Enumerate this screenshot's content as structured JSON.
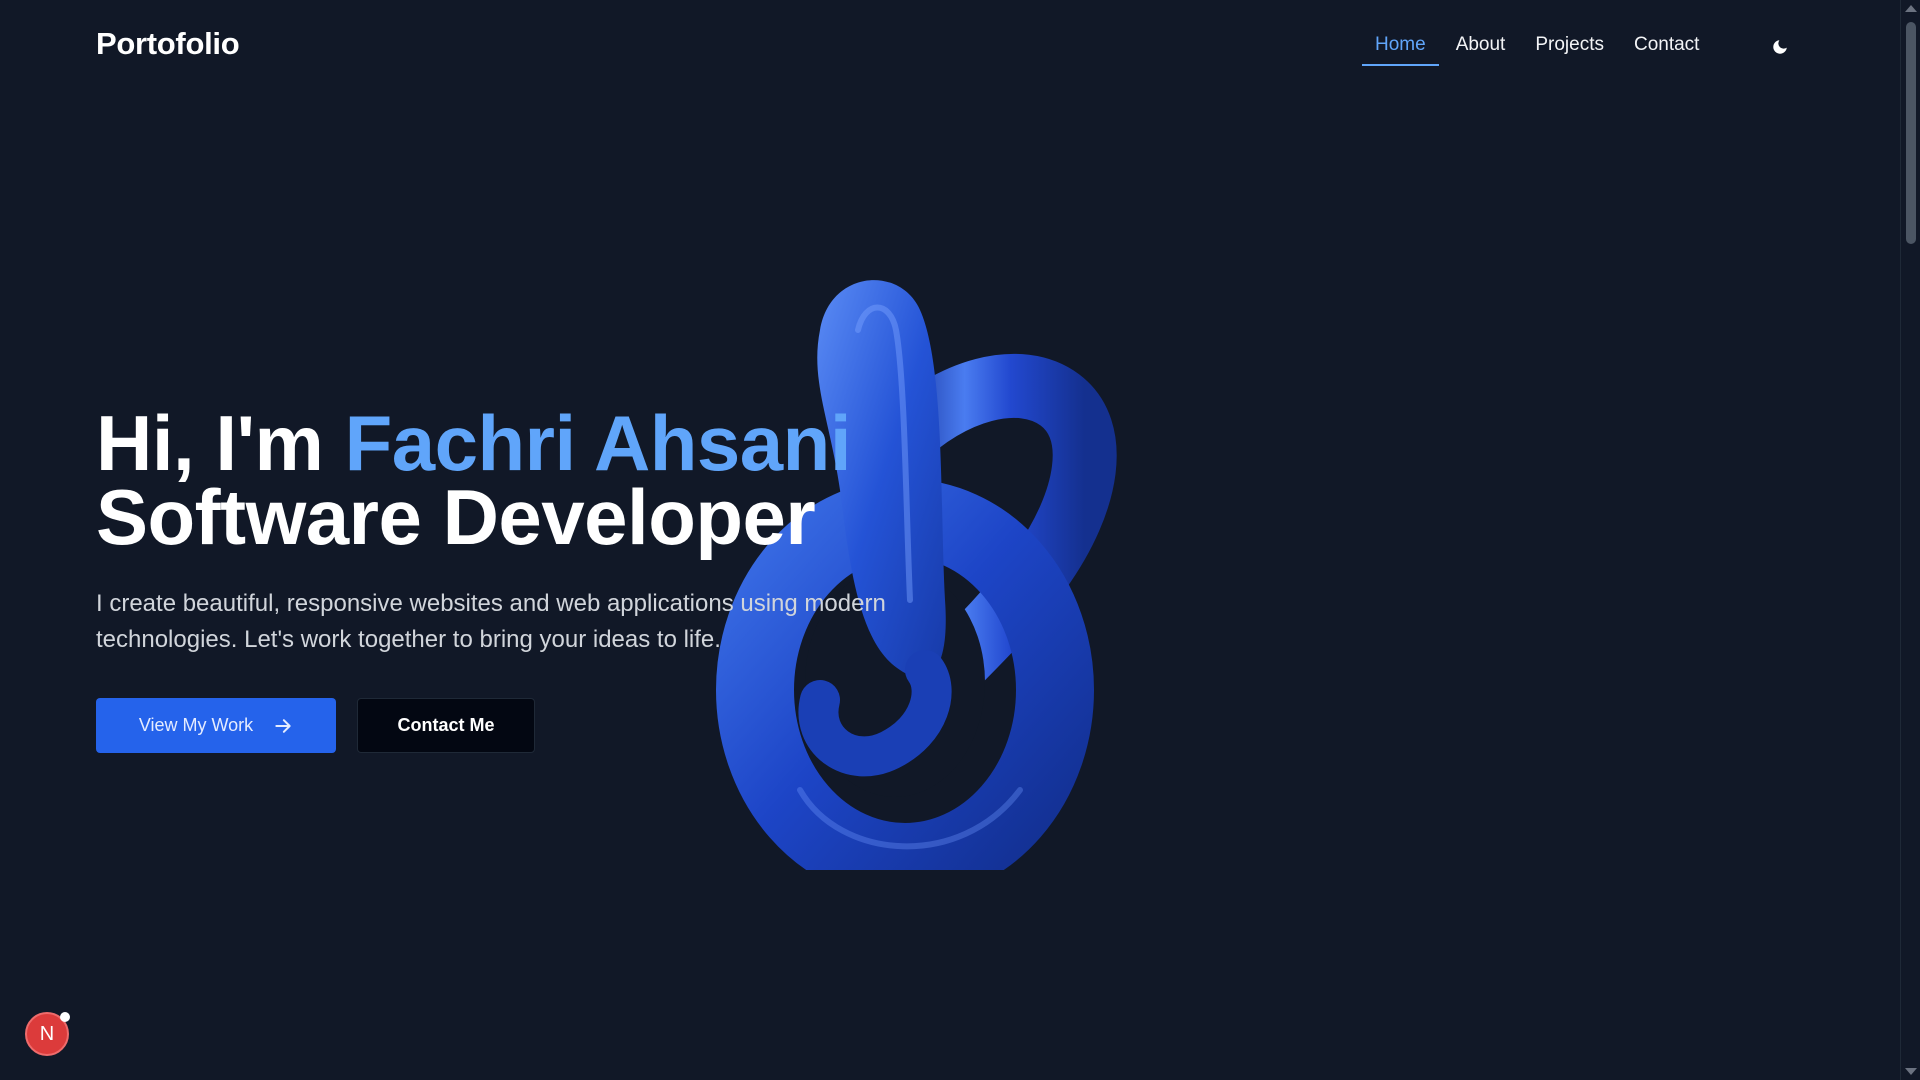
{
  "header": {
    "brand": "Portofolio",
    "nav": [
      {
        "label": "Home",
        "active": true
      },
      {
        "label": "About",
        "active": false
      },
      {
        "label": "Projects",
        "active": false
      },
      {
        "label": "Contact",
        "active": false
      }
    ],
    "theme_icon": "moon-icon"
  },
  "hero": {
    "greeting": "Hi, I'm ",
    "name": "Fachri Ahsani",
    "role": "Software Developer",
    "description": "I create beautiful, responsive websites and web applications using modern technologies. Let's work together to bring your ideas to life.",
    "primary_button": "View My Work",
    "secondary_button": "Contact Me",
    "primary_icon": "arrow-right-icon"
  },
  "badge": {
    "letter": "N"
  },
  "colors": {
    "background": "#111827",
    "accent": "#60a5fa",
    "primary_button": "#2563eb",
    "knot": "#1e40af"
  }
}
